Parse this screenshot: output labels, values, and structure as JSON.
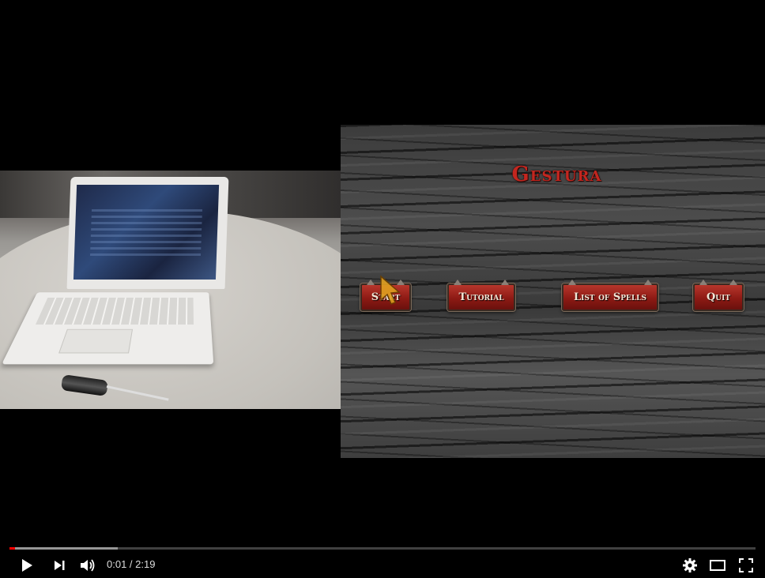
{
  "game": {
    "title": "Gestura",
    "buttons": {
      "start": "Start",
      "tutorial": "Tutorial",
      "spells": "List of Spells",
      "quit": "Quit"
    }
  },
  "player": {
    "current_time": "0:01",
    "separator": " / ",
    "duration": "2:19",
    "progress_fraction": 0.0072,
    "buffered_fraction": 0.145,
    "accent_color": "#ff0000"
  },
  "icons": {
    "play": "play-icon",
    "next": "next-icon",
    "volume": "volume-icon",
    "settings": "gear-icon",
    "theater": "theater-mode-icon",
    "fullscreen": "fullscreen-icon"
  }
}
